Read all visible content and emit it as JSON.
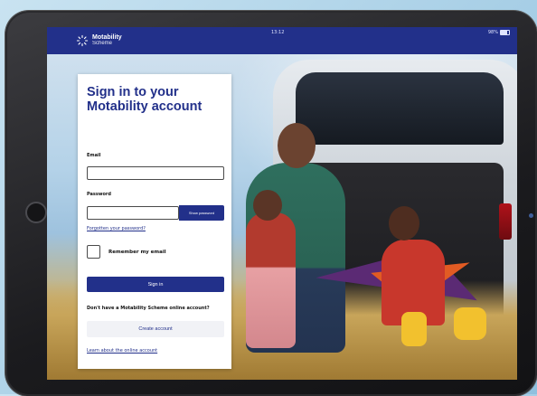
{
  "status_bar": {
    "time": "13:12",
    "battery": "98%"
  },
  "header": {
    "brand_name": "Motability",
    "brand_sub": "Scheme"
  },
  "signin": {
    "title": "Sign in to your Motability account",
    "email_label": "Email",
    "email_value": "",
    "password_label": "Password",
    "password_value": "",
    "show_password_label": "Show password",
    "forgotten_password_link": "Forgotten your password?",
    "remember_label": "Remember my email",
    "remember_checked": false,
    "signin_button": "Sign in",
    "no_account_text": "Don't have a Motability Scheme online account?",
    "create_account_button": "Create account",
    "learn_more_link": "Learn about the online account"
  },
  "colors": {
    "brand_blue": "#22308a",
    "card_bg": "#ffffff",
    "secondary_button_bg": "#f1f2f6"
  },
  "icons": [
    "motability-logo-icon",
    "battery-icon",
    "home-button-icon"
  ]
}
